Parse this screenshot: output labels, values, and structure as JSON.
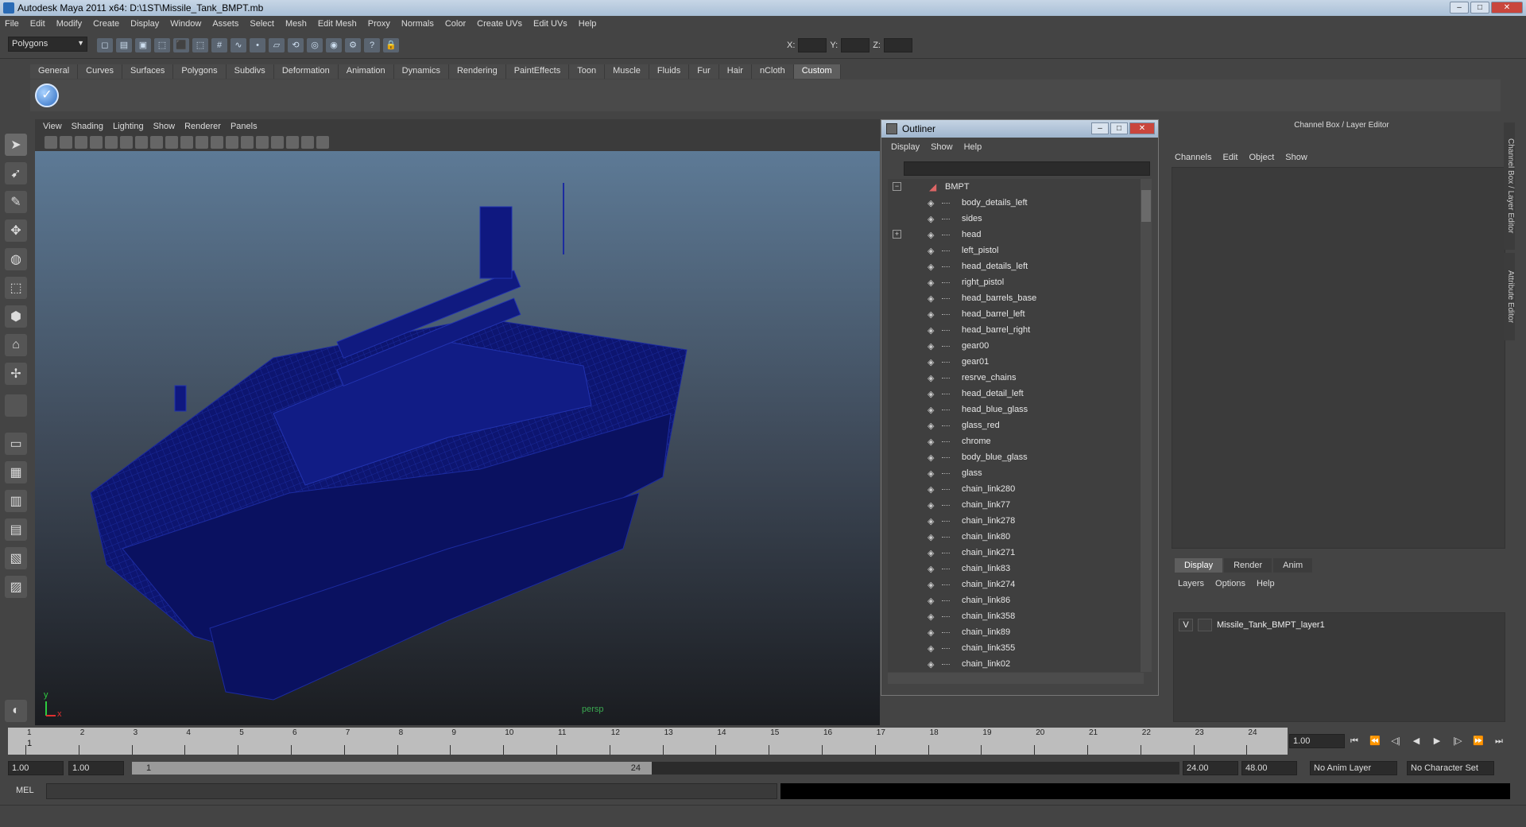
{
  "window": {
    "title": "Autodesk Maya 2011 x64: D:\\1ST\\Missile_Tank_BMPT.mb"
  },
  "menubar": [
    "File",
    "Edit",
    "Modify",
    "Create",
    "Display",
    "Window",
    "Assets",
    "Select",
    "Mesh",
    "Edit Mesh",
    "Proxy",
    "Normals",
    "Color",
    "Create UVs",
    "Edit UVs",
    "Help"
  ],
  "statusline": {
    "mode": "Polygons",
    "x_label": "X:",
    "y_label": "Y:",
    "z_label": "Z:"
  },
  "shelf": {
    "tabs": [
      "General",
      "Curves",
      "Surfaces",
      "Polygons",
      "Subdivs",
      "Deformation",
      "Animation",
      "Dynamics",
      "Rendering",
      "PaintEffects",
      "Toon",
      "Muscle",
      "Fluids",
      "Fur",
      "Hair",
      "nCloth",
      "Custom"
    ],
    "active_tab": "Custom"
  },
  "viewport": {
    "menu": [
      "View",
      "Shading",
      "Lighting",
      "Show",
      "Renderer",
      "Panels"
    ],
    "camera": "persp",
    "axis_y": "y",
    "axis_x": "x",
    "wire_color": "#0d1570"
  },
  "outliner": {
    "title": "Outliner",
    "menu": [
      "Display",
      "Show",
      "Help"
    ],
    "root": "BMPT",
    "items": [
      "body_details_left",
      "sides",
      "head",
      "left_pistol",
      "head_details_left",
      "right_pistol",
      "head_barrels_base",
      "head_barrel_left",
      "head_barrel_right",
      "gear00",
      "gear01",
      "resrve_chains",
      "head_detail_left",
      "head_blue_glass",
      "glass_red",
      "chrome",
      "body_blue_glass",
      "glass",
      "chain_link280",
      "chain_link77",
      "chain_link278",
      "chain_link80",
      "chain_link271",
      "chain_link83",
      "chain_link274",
      "chain_link86",
      "chain_link358",
      "chain_link89",
      "chain_link355",
      "chain_link02"
    ]
  },
  "channelbox": {
    "title": "Channel Box / Layer Editor",
    "menu": [
      "Channels",
      "Edit",
      "Object",
      "Show"
    ],
    "layer_tabs": [
      "Display",
      "Render",
      "Anim"
    ],
    "layer_menu": [
      "Layers",
      "Options",
      "Help"
    ],
    "layer": {
      "visible": "V",
      "name": "Missile_Tank_BMPT_layer1"
    },
    "side_tabs": [
      "Channel Box / Layer Editor",
      "Attribute Editor"
    ]
  },
  "timeline": {
    "ticks": [
      "1",
      "2",
      "3",
      "4",
      "5",
      "6",
      "7",
      "8",
      "9",
      "10",
      "11",
      "12",
      "13",
      "14",
      "15",
      "16",
      "17",
      "18",
      "19",
      "20",
      "21",
      "22",
      "23",
      "24"
    ],
    "current": "1",
    "current_field": "1.00"
  },
  "range": {
    "start": "1.00",
    "start2": "1.00",
    "slider_start": "1",
    "slider_end": "24",
    "end": "24.00",
    "end2": "48.00",
    "anim_layer": "No Anim Layer",
    "char_set": "No Character Set"
  },
  "command": {
    "label": "MEL"
  },
  "colors": {
    "accent": "#5e5e5e",
    "bg": "#444444",
    "wire": "#0d1570"
  }
}
